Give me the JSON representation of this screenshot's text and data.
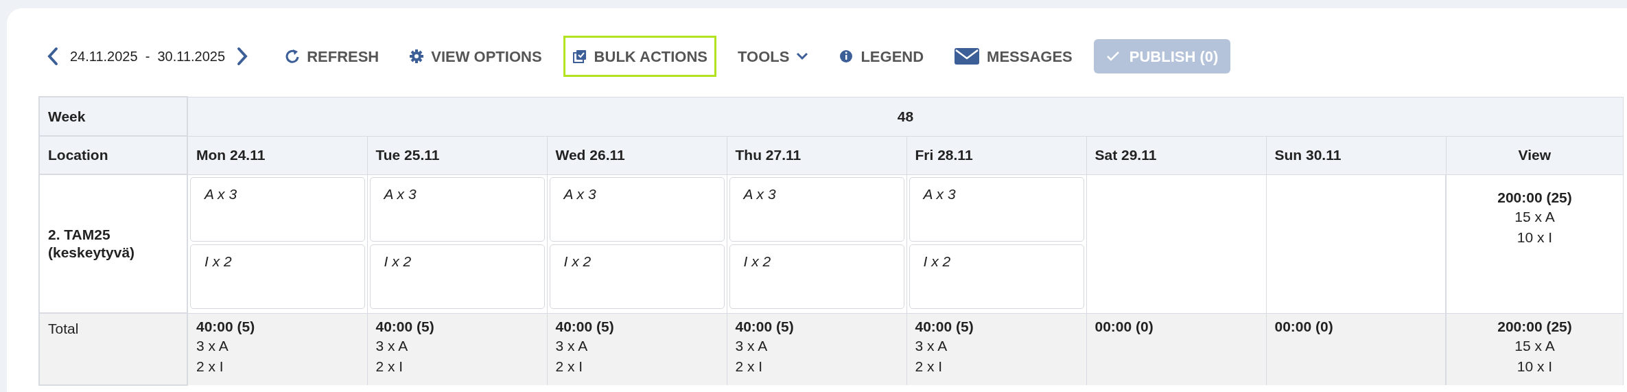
{
  "toolbar": {
    "date_range": "24.11.2025  -  30.11.2025",
    "actions": [
      {
        "kind": "refresh",
        "label": "REFRESH",
        "highlighted": false
      },
      {
        "kind": "view-options",
        "label": "VIEW OPTIONS",
        "highlighted": false
      },
      {
        "kind": "bulk-actions",
        "label": "BULK ACTIONS",
        "highlighted": true
      },
      {
        "kind": "tools",
        "label": "TOOLS",
        "highlighted": false
      },
      {
        "kind": "legend",
        "label": "LEGEND",
        "highlighted": false
      },
      {
        "kind": "messages",
        "label": "MESSAGES",
        "highlighted": false
      }
    ],
    "publish": {
      "label": "PUBLISH (0)",
      "disabled": true
    }
  },
  "table": {
    "week_label": "Week",
    "week": "48",
    "location_label": "Location",
    "days": [
      "Mon 24.11",
      "Tue 25.11",
      "Wed 26.11",
      "Thu 27.11",
      "Fri 28.11",
      "Sat 29.11",
      "Sun 30.11"
    ],
    "view_label": "View",
    "rows": [
      {
        "location": "2. TAM25 (keskeytyvä)",
        "cells": [
          [
            "A x 3",
            "I x 2"
          ],
          [
            "A x 3",
            "I x 2"
          ],
          [
            "A x 3",
            "I x 2"
          ],
          [
            "A x 3",
            "I x 2"
          ],
          [
            "A x 3",
            "I x 2"
          ],
          [],
          []
        ],
        "view": {
          "total": "200:00 (25)",
          "lines": [
            "15 x A",
            "10 x I"
          ]
        }
      }
    ],
    "total": {
      "label": "Total",
      "cells": [
        {
          "total": "40:00 (5)",
          "lines": [
            "3 x A",
            "2 x I"
          ]
        },
        {
          "total": "40:00 (5)",
          "lines": [
            "3 x A",
            "2 x I"
          ]
        },
        {
          "total": "40:00 (5)",
          "lines": [
            "3 x A",
            "2 x I"
          ]
        },
        {
          "total": "40:00 (5)",
          "lines": [
            "3 x A",
            "2 x I"
          ]
        },
        {
          "total": "40:00 (5)",
          "lines": [
            "3 x A",
            "2 x I"
          ]
        },
        {
          "total": "00:00 (0)"
        },
        {
          "total": "00:00 (0)"
        }
      ],
      "view": {
        "total": "200:00 (25)",
        "lines": [
          "15 x A",
          "10 x I"
        ]
      }
    }
  }
}
